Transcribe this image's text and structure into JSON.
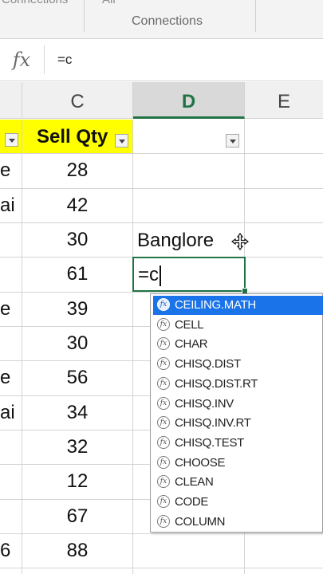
{
  "ribbon": {
    "tab_fragment_1": "Connections",
    "tab_fragment_2": "All",
    "group_label": "Connections"
  },
  "formula_bar": {
    "fx_label": "fx",
    "formula": "=c"
  },
  "columns": [
    "C",
    "D",
    "E"
  ],
  "selected_column": "D",
  "header_row": {
    "c_header": "Sell Qty"
  },
  "col_a_fragments": [
    "e",
    "ai",
    "",
    "",
    "e",
    "",
    "e",
    "ai",
    "",
    "",
    "",
    "6"
  ],
  "sell_qty": [
    "28",
    "42",
    "30",
    "61",
    "39",
    "30",
    "56",
    "34",
    "32",
    "12",
    "67",
    "88"
  ],
  "col_d": {
    "row3": "Banglore",
    "editing": "=c"
  },
  "autocomplete": {
    "items": [
      "CEILING.MATH",
      "CELL",
      "CHAR",
      "CHISQ.DIST",
      "CHISQ.DIST.RT",
      "CHISQ.INV",
      "CHISQ.INV.RT",
      "CHISQ.TEST",
      "CHOOSE",
      "CLEAN",
      "CODE",
      "COLUMN"
    ],
    "selected_index": 0,
    "icon": "function-icon"
  },
  "colors": {
    "header_fill": "#ffff00",
    "excel_green": "#217346",
    "selection_blue": "#1a73e8"
  }
}
